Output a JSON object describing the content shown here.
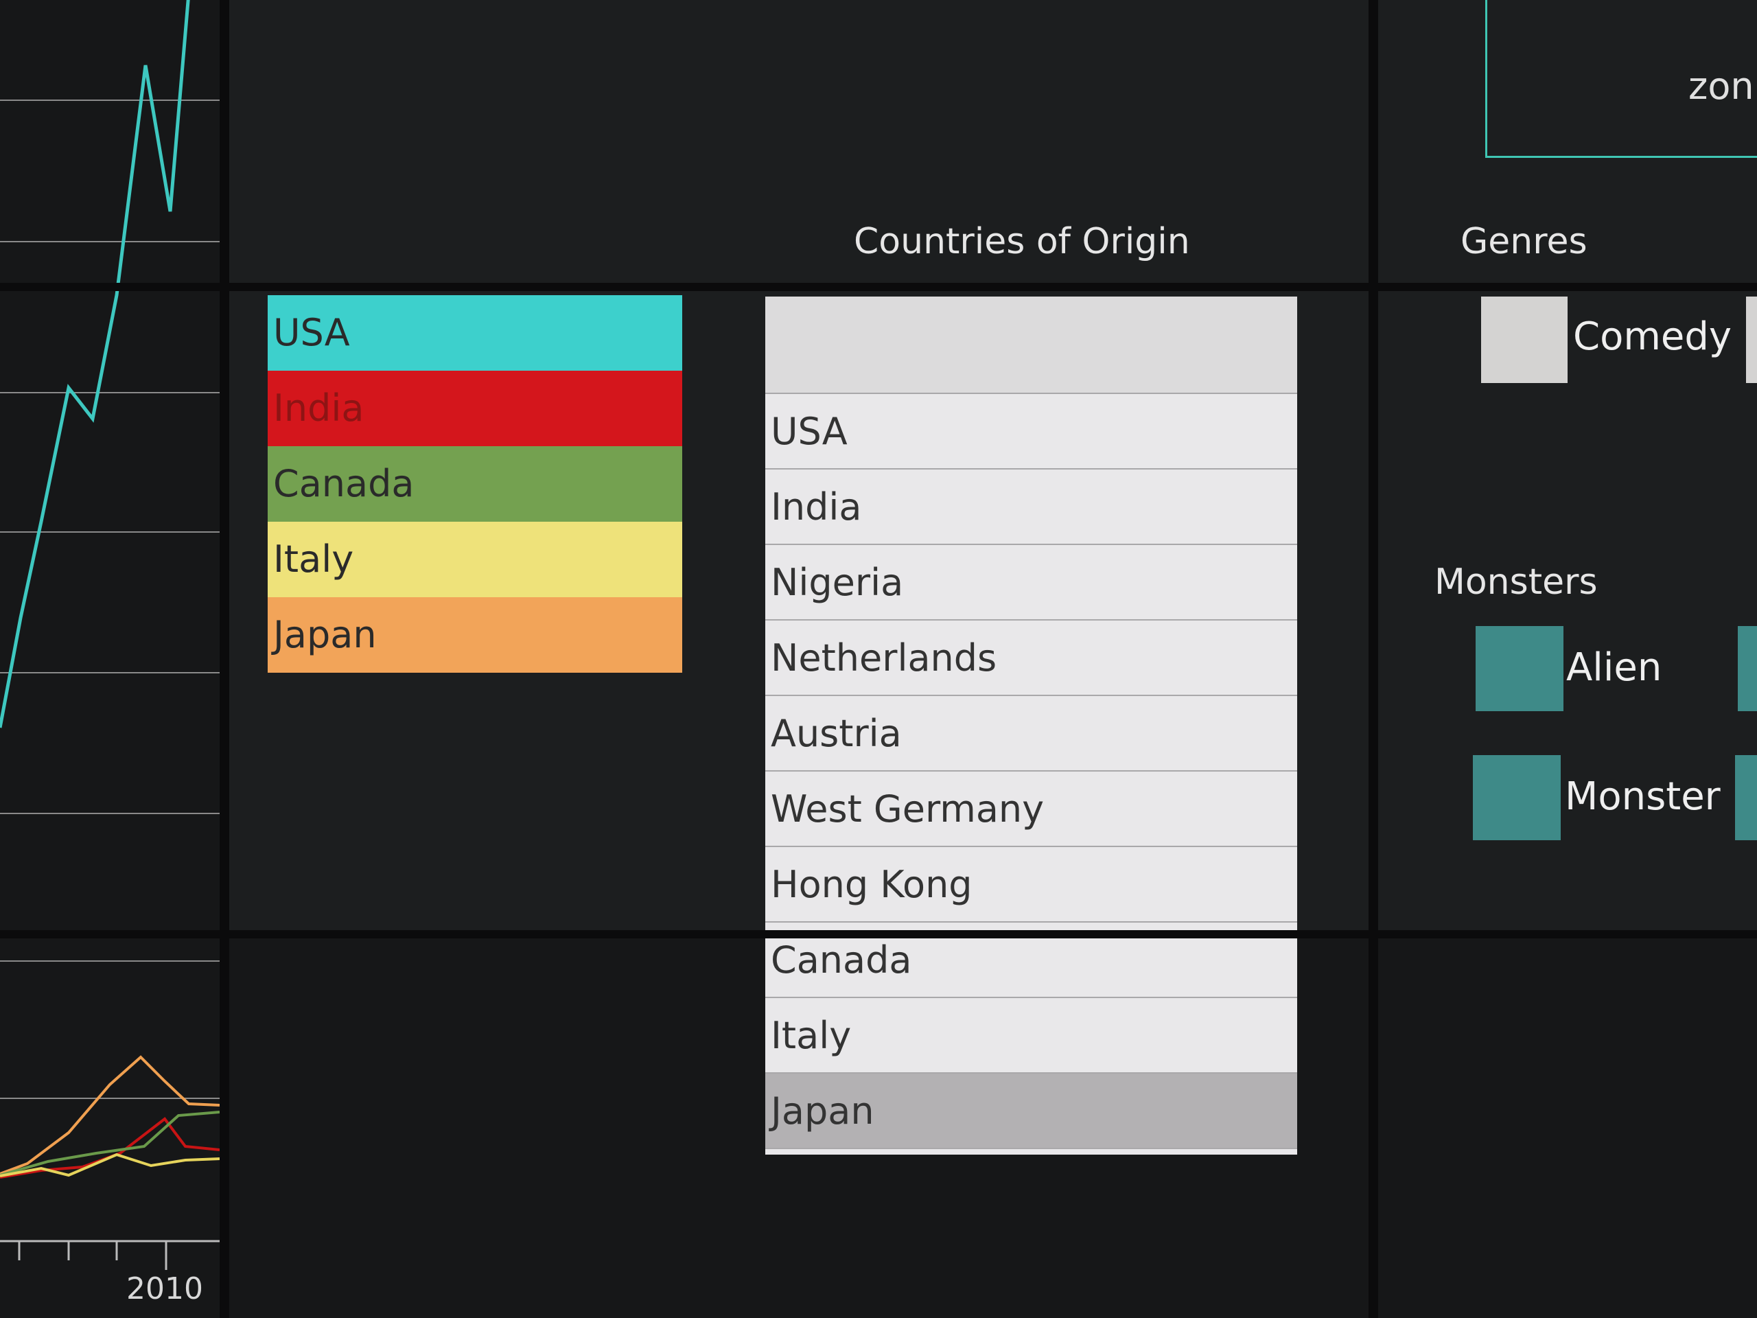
{
  "chart": {
    "year_label": "2010",
    "colors": {
      "usa": "#3ec8c0",
      "india": "#c81414",
      "canada": "#6a9a4a",
      "italy": "#e6d45c",
      "japan": "#f0a050",
      "grid": "#8a8a8a"
    }
  },
  "legend": {
    "items": [
      {
        "label": "USA",
        "color": "#3dd0cc"
      },
      {
        "label": "India",
        "color": "#d4161c"
      },
      {
        "label": "Canada",
        "color": "#74a150"
      },
      {
        "label": "Italy",
        "color": "#eee27a"
      },
      {
        "label": "Japan",
        "color": "#f2a459"
      }
    ]
  },
  "countries": {
    "title": "Countries of Origin",
    "items": [
      "USA",
      "India",
      "Nigeria",
      "Netherlands",
      "Austria",
      "West Germany",
      "Hong Kong",
      "Canada",
      "Italy",
      "Japan"
    ],
    "selected": "Japan"
  },
  "genres": {
    "title": "Genres",
    "items": [
      {
        "label": "Comedy",
        "color": "#d4d3d2"
      }
    ]
  },
  "zoom": {
    "label": "zon"
  },
  "monsters": {
    "title": "Monsters",
    "items": [
      {
        "label": "Alien",
        "color": "#3e8a88"
      },
      {
        "label": "Monster",
        "color": "#3e8a88"
      }
    ]
  }
}
